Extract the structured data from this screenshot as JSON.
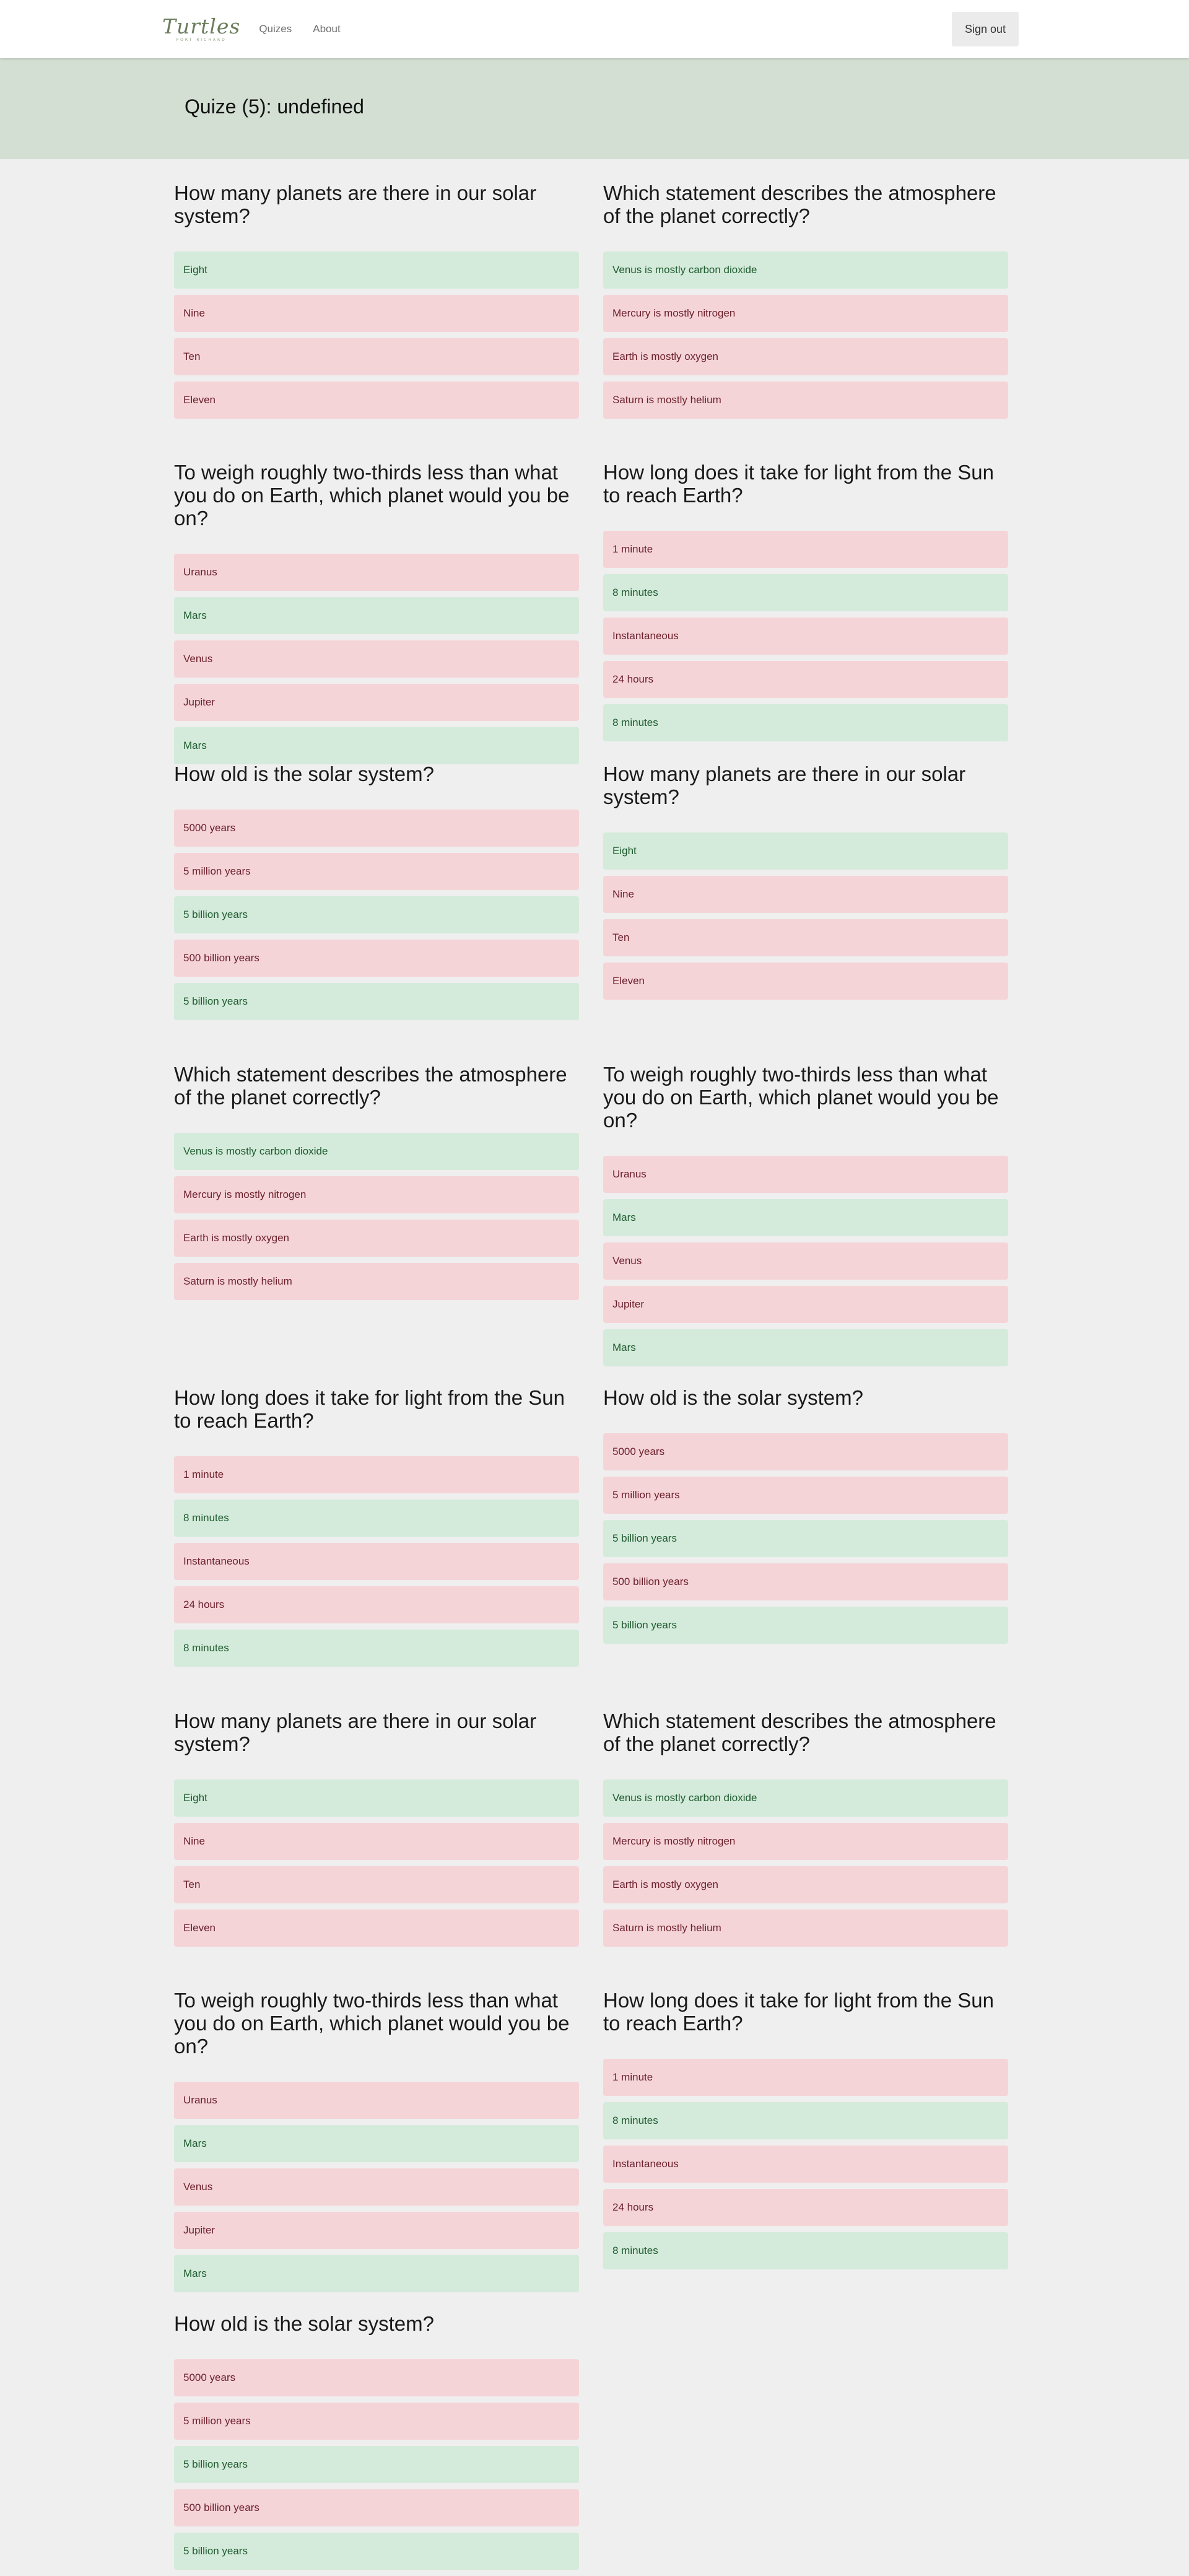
{
  "nav": {
    "logo_text": "Turtles",
    "logo_tagline": "PORT RICHARD",
    "links": [
      "Quizes",
      "About"
    ],
    "signout_label": "Sign out"
  },
  "page": {
    "title": "Quize (5): undefined"
  },
  "colors": {
    "correct_bg": "#d4ebdb",
    "wrong_bg": "#f5d4d8",
    "band_bg": "#d3dfd3"
  },
  "questions": [
    {
      "text": "How many planets are there in our solar system?",
      "answers": [
        {
          "label": "Eight",
          "correct": true
        },
        {
          "label": "Nine",
          "correct": false
        },
        {
          "label": "Ten",
          "correct": false
        },
        {
          "label": "Eleven",
          "correct": false
        }
      ]
    },
    {
      "text": "Which statement describes the atmosphere of the planet correctly?",
      "answers": [
        {
          "label": "Venus is mostly carbon dioxide",
          "correct": true
        },
        {
          "label": "Mercury is mostly nitrogen",
          "correct": false
        },
        {
          "label": "Earth is mostly oxygen",
          "correct": false
        },
        {
          "label": "Saturn is mostly helium",
          "correct": false
        }
      ]
    },
    {
      "text": "To weigh roughly two-thirds less than what you do on Earth, which planet would you be on?",
      "answers": [
        {
          "label": "Uranus",
          "correct": false
        },
        {
          "label": "Mars",
          "correct": true
        },
        {
          "label": "Venus",
          "correct": false
        },
        {
          "label": "Jupiter",
          "correct": false
        },
        {
          "label": "Mars",
          "correct": true
        }
      ]
    },
    {
      "text": "How long does it take for light from the Sun to reach Earth?",
      "answers": [
        {
          "label": "1 minute",
          "correct": false
        },
        {
          "label": "8 minutes",
          "correct": true
        },
        {
          "label": "Instantaneous",
          "correct": false
        },
        {
          "label": "24 hours",
          "correct": false
        },
        {
          "label": "8 minutes",
          "correct": true
        }
      ]
    },
    {
      "text": "How old is the solar system?",
      "answers": [
        {
          "label": "5000 years",
          "correct": false
        },
        {
          "label": "5 million years",
          "correct": false
        },
        {
          "label": "5 billion years",
          "correct": true
        },
        {
          "label": "500 billion years",
          "correct": false
        },
        {
          "label": "5 billion years",
          "correct": true
        }
      ]
    },
    {
      "text": "How many planets are there in our solar system?",
      "answers": [
        {
          "label": "Eight",
          "correct": true
        },
        {
          "label": "Nine",
          "correct": false
        },
        {
          "label": "Ten",
          "correct": false
        },
        {
          "label": "Eleven",
          "correct": false
        }
      ]
    },
    {
      "text": "Which statement describes the atmosphere of the planet correctly?",
      "answers": [
        {
          "label": "Venus is mostly carbon dioxide",
          "correct": true
        },
        {
          "label": "Mercury is mostly nitrogen",
          "correct": false
        },
        {
          "label": "Earth is mostly oxygen",
          "correct": false
        },
        {
          "label": "Saturn is mostly helium",
          "correct": false
        }
      ]
    },
    {
      "text": "To weigh roughly two-thirds less than what you do on Earth, which planet would you be on?",
      "answers": [
        {
          "label": "Uranus",
          "correct": false
        },
        {
          "label": "Mars",
          "correct": true
        },
        {
          "label": "Venus",
          "correct": false
        },
        {
          "label": "Jupiter",
          "correct": false
        },
        {
          "label": "Mars",
          "correct": true
        }
      ]
    },
    {
      "text": "How long does it take for light from the Sun to reach Earth?",
      "answers": [
        {
          "label": "1 minute",
          "correct": false
        },
        {
          "label": "8 minutes",
          "correct": true
        },
        {
          "label": "Instantaneous",
          "correct": false
        },
        {
          "label": "24 hours",
          "correct": false
        },
        {
          "label": "8 minutes",
          "correct": true
        }
      ]
    },
    {
      "text": "How old is the solar system?",
      "answers": [
        {
          "label": "5000 years",
          "correct": false
        },
        {
          "label": "5 million years",
          "correct": false
        },
        {
          "label": "5 billion years",
          "correct": true
        },
        {
          "label": "500 billion years",
          "correct": false
        },
        {
          "label": "5 billion years",
          "correct": true
        }
      ]
    },
    {
      "text": "How many planets are there in our solar system?",
      "answers": [
        {
          "label": "Eight",
          "correct": true
        },
        {
          "label": "Nine",
          "correct": false
        },
        {
          "label": "Ten",
          "correct": false
        },
        {
          "label": "Eleven",
          "correct": false
        }
      ]
    },
    {
      "text": "Which statement describes the atmosphere of the planet correctly?",
      "answers": [
        {
          "label": "Venus is mostly carbon dioxide",
          "correct": true
        },
        {
          "label": "Mercury is mostly nitrogen",
          "correct": false
        },
        {
          "label": "Earth is mostly oxygen",
          "correct": false
        },
        {
          "label": "Saturn is mostly helium",
          "correct": false
        }
      ]
    },
    {
      "text": "To weigh roughly two-thirds less than what you do on Earth, which planet would you be on?",
      "answers": [
        {
          "label": "Uranus",
          "correct": false
        },
        {
          "label": "Mars",
          "correct": true
        },
        {
          "label": "Venus",
          "correct": false
        },
        {
          "label": "Jupiter",
          "correct": false
        },
        {
          "label": "Mars",
          "correct": true
        }
      ]
    },
    {
      "text": "How long does it take for light from the Sun to reach Earth?",
      "answers": [
        {
          "label": "1 minute",
          "correct": false
        },
        {
          "label": "8 minutes",
          "correct": true
        },
        {
          "label": "Instantaneous",
          "correct": false
        },
        {
          "label": "24 hours",
          "correct": false
        },
        {
          "label": "8 minutes",
          "correct": true
        }
      ]
    },
    {
      "text": "How old is the solar system?",
      "answers": [
        {
          "label": "5000 years",
          "correct": false
        },
        {
          "label": "5 million years",
          "correct": false
        },
        {
          "label": "5 billion years",
          "correct": true
        },
        {
          "label": "500 billion years",
          "correct": false
        },
        {
          "label": "5 billion years",
          "correct": true
        }
      ]
    }
  ]
}
